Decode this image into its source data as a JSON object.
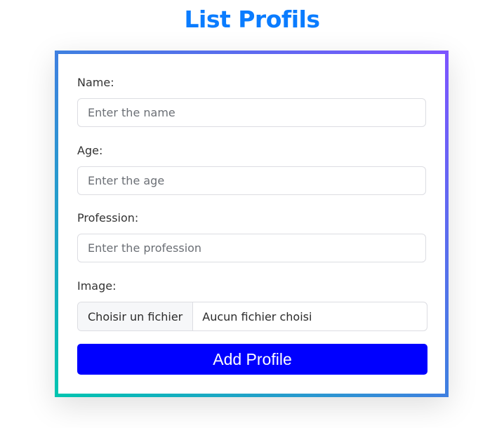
{
  "title": "List Profils",
  "form": {
    "name": {
      "label": "Name:",
      "placeholder": "Enter the name",
      "value": ""
    },
    "age": {
      "label": "Age:",
      "placeholder": "Enter the age",
      "value": ""
    },
    "profession": {
      "label": "Profession:",
      "placeholder": "Enter the profession",
      "value": ""
    },
    "image": {
      "label": "Image:",
      "button_label": "Choisir un fichier",
      "status": "Aucun fichier choisi"
    },
    "submit_label": "Add Profile"
  },
  "colors": {
    "title": "#0a7cff",
    "button": "#0000ff",
    "border_gradient": [
      "#00c4b0",
      "#7c55ff"
    ]
  }
}
